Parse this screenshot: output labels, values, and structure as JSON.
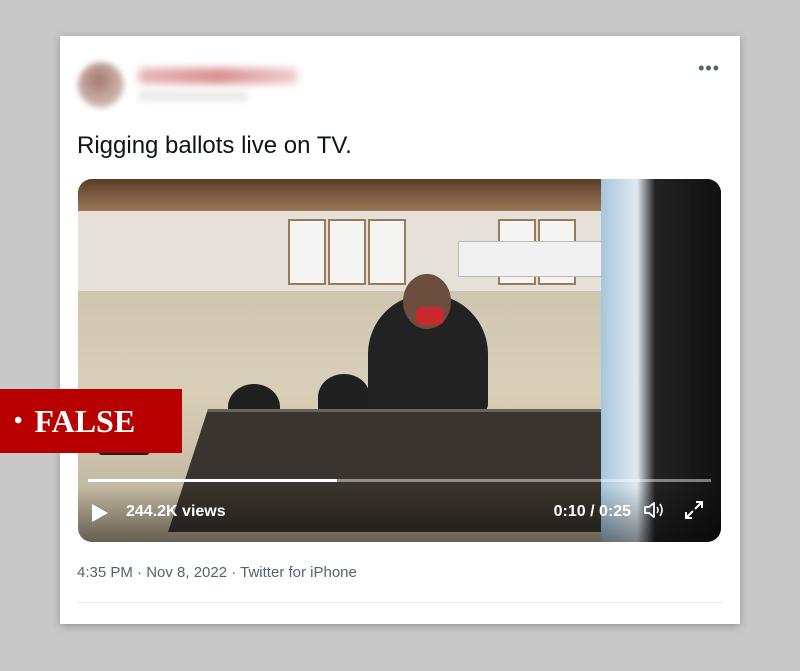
{
  "tweet": {
    "more_icon": "•••",
    "text": "Rigging ballots live on TV.",
    "timestamp": "4:35 PM · Nov 8, 2022 · Twitter for iPhone"
  },
  "video": {
    "views": "244.2K views",
    "time": "0:10 / 0:25",
    "progress": 0.4,
    "volume_icon": "volume-icon",
    "fullscreen_icon": "fullscreen-icon"
  },
  "label": {
    "bullet": "•",
    "text": "FALSE",
    "color": "#b80000"
  }
}
